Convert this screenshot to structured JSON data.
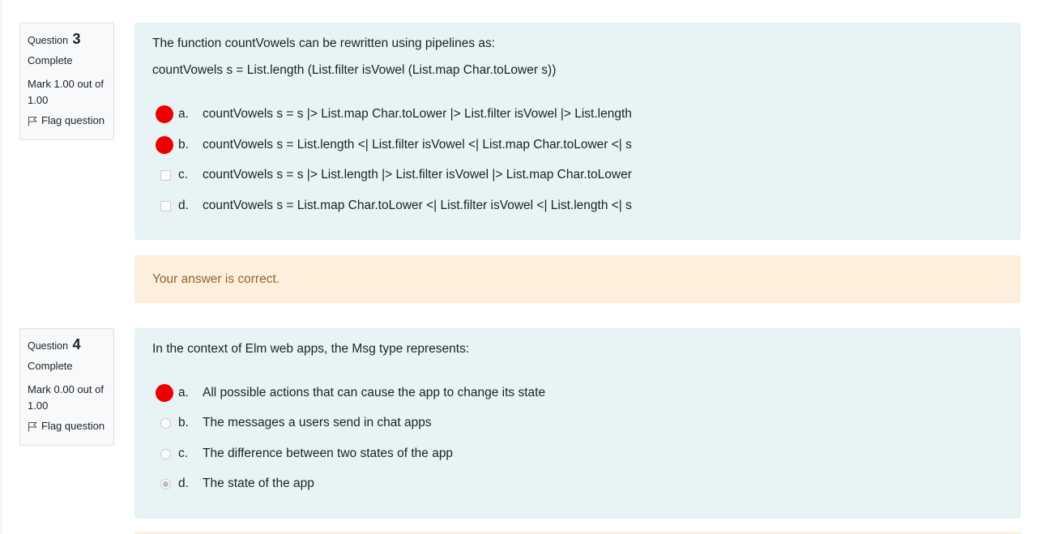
{
  "questions": [
    {
      "label": "Question",
      "number": "3",
      "state": "Complete",
      "grade": "Mark 1.00 out of 1.00",
      "flag_label": "Flag question",
      "text_lines": [
        "The function countVowels can be rewritten using pipelines as:",
        "countVowels s = List.length (List.filter isVowel (List.map Char.toLower s))"
      ],
      "options": [
        {
          "letter": "a.",
          "text": "countVowels s = s |> List.map Char.toLower |> List.filter isVowel |> List.length",
          "marker": "selected-red"
        },
        {
          "letter": "b.",
          "text": "countVowels s = List.length <| List.filter isVowel  <| List.map Char.toLower <| s",
          "marker": "selected-red"
        },
        {
          "letter": "c.",
          "text": "countVowels s = s |> List.length |> List.filter isVowel  |> List.map Char.toLower",
          "marker": "checkbox"
        },
        {
          "letter": "d.",
          "text": "countVowels s = List.map Char.toLower <| List.filter isVowel <| List.length <| s",
          "marker": "checkbox"
        }
      ],
      "feedback": "Your answer is correct."
    },
    {
      "label": "Question",
      "number": "4",
      "state": "Complete",
      "grade": "Mark 0.00 out of 1.00",
      "flag_label": "Flag question",
      "text_lines": [
        "In the context of Elm web apps, the Msg type represents:"
      ],
      "options": [
        {
          "letter": "a.",
          "text": "All possible actions that can cause the app to change its state",
          "marker": "selected-red"
        },
        {
          "letter": "b.",
          "text": "The messages a users send in chat apps",
          "marker": "radio"
        },
        {
          "letter": "c.",
          "text": "The difference between two states of the app",
          "marker": "radio"
        },
        {
          "letter": "d.",
          "text": "The state of the app",
          "marker": "radio-checked"
        }
      ]
    }
  ],
  "colors": {
    "formulation_bg": "#e7f3f5",
    "feedback_bg": "#fcefdc",
    "feedback_text": "#8e662e",
    "selected_marker": "#ee0000"
  }
}
